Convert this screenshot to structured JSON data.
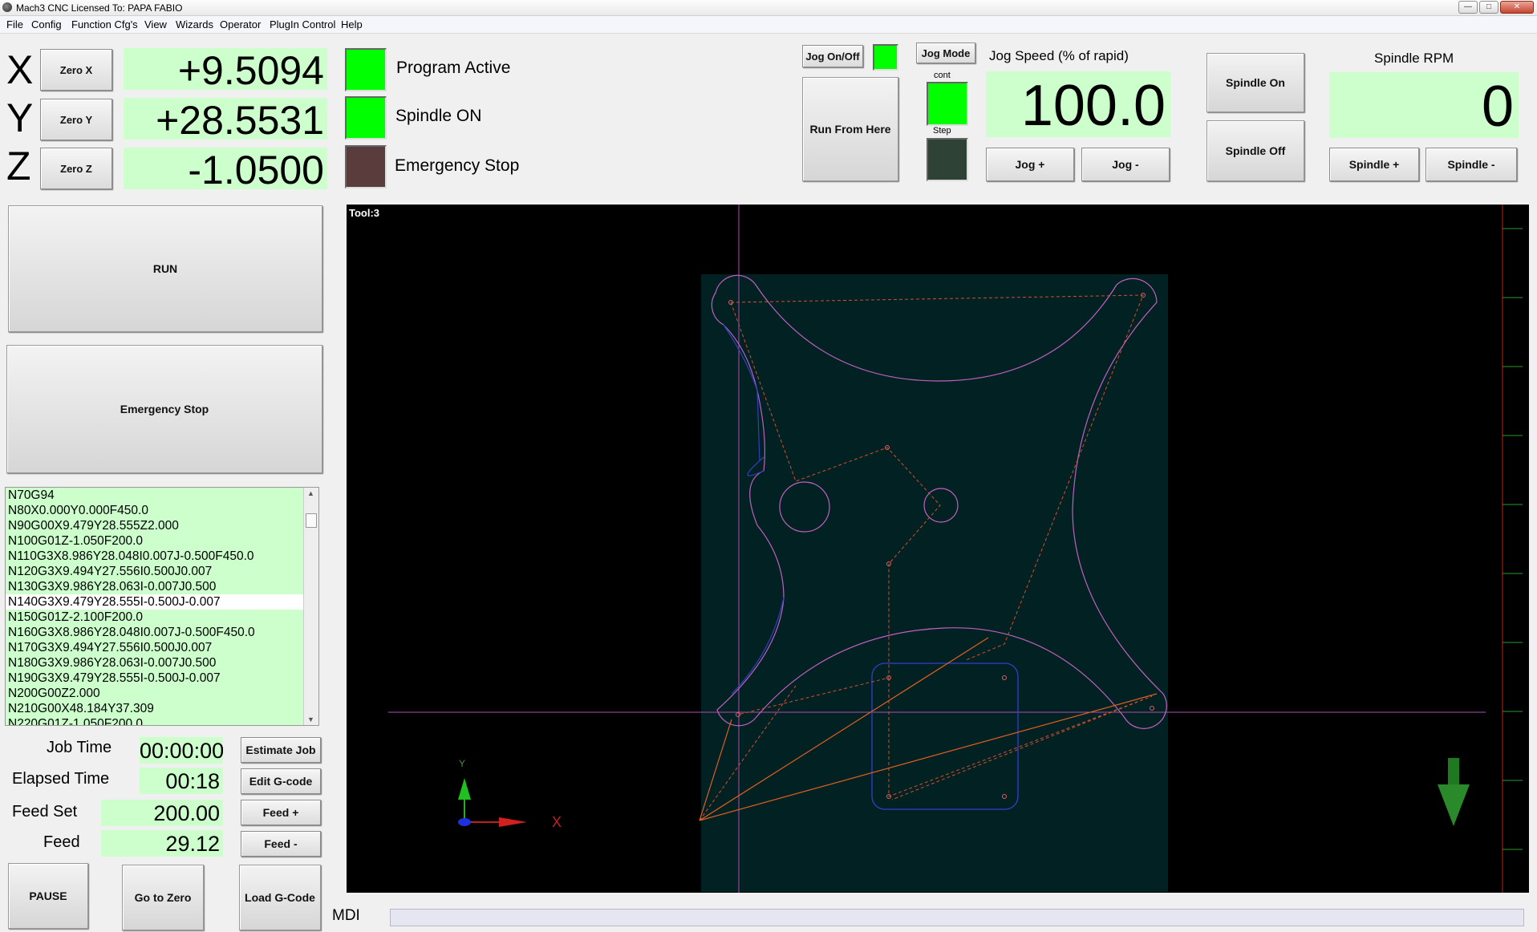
{
  "window": {
    "title": "Mach3 CNC  Licensed To: PAPA FABIO"
  },
  "menu": [
    "File",
    "Config",
    "Function Cfg's",
    "View",
    "Wizards",
    "Operator",
    "PlugIn Control",
    "Help"
  ],
  "axes": [
    {
      "letter": "X",
      "zero_label": "Zero X",
      "value": "+9.5094"
    },
    {
      "letter": "Y",
      "zero_label": "Zero Y",
      "value": "+28.5531"
    },
    {
      "letter": "Z",
      "zero_label": "Zero Z",
      "value": "-1.0500"
    }
  ],
  "status": {
    "program_active": "Program Active",
    "spindle_on": "Spindle ON",
    "emergency_stop": "Emergency Stop"
  },
  "buttons": {
    "run": "RUN",
    "estop": "Emergency Stop",
    "estimate_job": "Estimate Job",
    "edit_gcode": "Edit G-code",
    "feed_plus": "Feed +",
    "feed_minus": "Feed -",
    "pause": "PAUSE",
    "go_to_zero": "Go to Zero",
    "load_gcode": "Load G-Code",
    "jog_onoff": "Jog On/Off",
    "jog_mode": "Jog Mode",
    "run_from_here": "Run From Here",
    "jog_plus": "Jog +",
    "jog_minus": "Jog -",
    "spindle_on": "Spindle On",
    "spindle_off": "Spindle Off",
    "spindle_plus": "Spindle +",
    "spindle_minus": "Spindle -"
  },
  "jog": {
    "cont_label": "cont",
    "step_label": "Step",
    "speed_label": "Jog Speed (% of rapid)",
    "speed_value": "100.0"
  },
  "spindle": {
    "rpm_label": "Spindle RPM",
    "rpm_value": "0"
  },
  "gcode": {
    "lines": [
      "N70G94",
      "N80X0.000Y0.000F450.0",
      "N90G00X9.479Y28.555Z2.000",
      "N100G01Z-1.050F200.0",
      "N110G3X8.986Y28.048I0.007J-0.500F450.0",
      "N120G3X9.494Y27.556I0.500J0.007",
      "N130G3X9.986Y28.063I-0.007J0.500",
      "N140G3X9.479Y28.555I-0.500J-0.007",
      "N150G01Z-2.100F200.0",
      "N160G3X8.986Y28.048I0.007J-0.500F450.0",
      "N170G3X9.494Y27.556I0.500J0.007",
      "N180G3X9.986Y28.063I-0.007J0.500",
      "N190G3X9.479Y28.555I-0.500J-0.007",
      "N200G00Z2.000",
      "N210G00X48.184Y37.309",
      "N220G01Z-1.050F200.0"
    ],
    "highlight_index": 7
  },
  "info": {
    "job_time_label": "Job Time",
    "job_time_value": "00:00:00",
    "elapsed_label": "Elapsed Time",
    "elapsed_value": "00:18",
    "feed_set_label": "Feed Set",
    "feed_set_value": "200.00",
    "feed_label": "Feed",
    "feed_value": "29.12"
  },
  "toolpath": {
    "tool_label": "Tool:3",
    "axis_y_label": "Y",
    "axis_x_label": "X"
  },
  "mdi": {
    "label": "MDI"
  },
  "colors": {
    "dro_bg": "#ccffcc",
    "led_green": "#00ff00",
    "estop_led": "#5a3c3c",
    "path_magenta": "#c060c0",
    "path_orange": "#e06020"
  }
}
